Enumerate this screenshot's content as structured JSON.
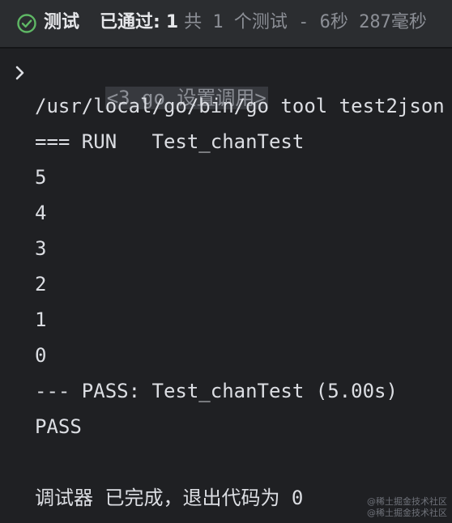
{
  "status": {
    "title": "测试",
    "passed_label": "已通过:",
    "passed_count": "1",
    "details": "共 1 个测试 - 6秒 287毫秒"
  },
  "console": {
    "command": "<3 go 设置调用>",
    "lines": [
      "/usr/local/go/bin/go tool test2json",
      "=== RUN   Test_chanTest",
      "5",
      "4",
      "3",
      "2",
      "1",
      "0",
      "--- PASS: Test_chanTest (5.00s)",
      "PASS",
      "",
      "调试器 已完成，退出代码为 0"
    ]
  },
  "watermark": {
    "line1": "@稀土掘金技术社区",
    "line2": "@稀土掘金技术社区"
  },
  "colors": {
    "success": "#5fb865",
    "panel": "#2b2d30",
    "console_bg": "#1f2023"
  },
  "icons": {
    "status": "check-circle-icon",
    "expand": "chevron-right-icon"
  }
}
